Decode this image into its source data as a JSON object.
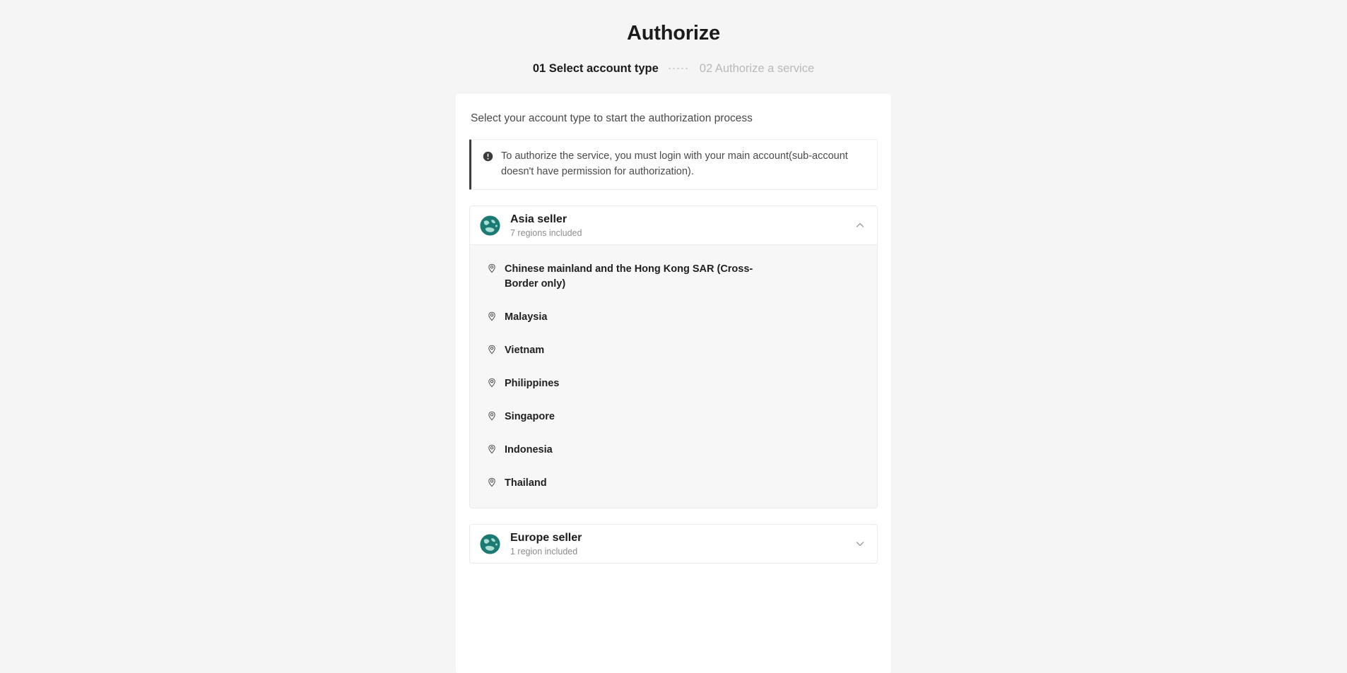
{
  "header": {
    "title": "Authorize",
    "steps": [
      {
        "number": "01",
        "label": "Select account type",
        "full": "01 Select account type",
        "state": "active"
      },
      {
        "number": "02",
        "label": "Authorize a service",
        "full": "02 Authorize a service",
        "state": "inactive"
      }
    ]
  },
  "main": {
    "lead": "Select your account type to start the authorization process",
    "banner": {
      "icon": "info-circle-icon",
      "text": "To authorize the service, you must login with your main account(sub-account doesn't have permission for authorization)."
    },
    "sellers": [
      {
        "name": "Asia seller",
        "subtitle": "7 regions included",
        "icon": "globe-icon",
        "expanded": true,
        "chevron": "chevron-up-icon",
        "regions": [
          "Chinese mainland and the Hong Kong SAR (Cross-Border only)",
          "Malaysia",
          "Vietnam",
          "Philippines",
          "Singapore",
          "Indonesia",
          "Thailand"
        ]
      },
      {
        "name": "Europe seller",
        "subtitle": "1 region included",
        "icon": "globe-icon",
        "expanded": false,
        "chevron": "chevron-down-icon",
        "regions": []
      }
    ]
  },
  "colors": {
    "page_background": "#f5f5f5",
    "card_background": "#ffffff",
    "region_list_background": "#f7f7f7",
    "globe_teal": "#1c7a72",
    "globe_land": "#a8ddd6",
    "banner_accent": "#3d3d3d",
    "text_primary": "#1b1b1b",
    "text_muted": "#8c8c8c",
    "step_inactive": "#b9b9b9"
  }
}
